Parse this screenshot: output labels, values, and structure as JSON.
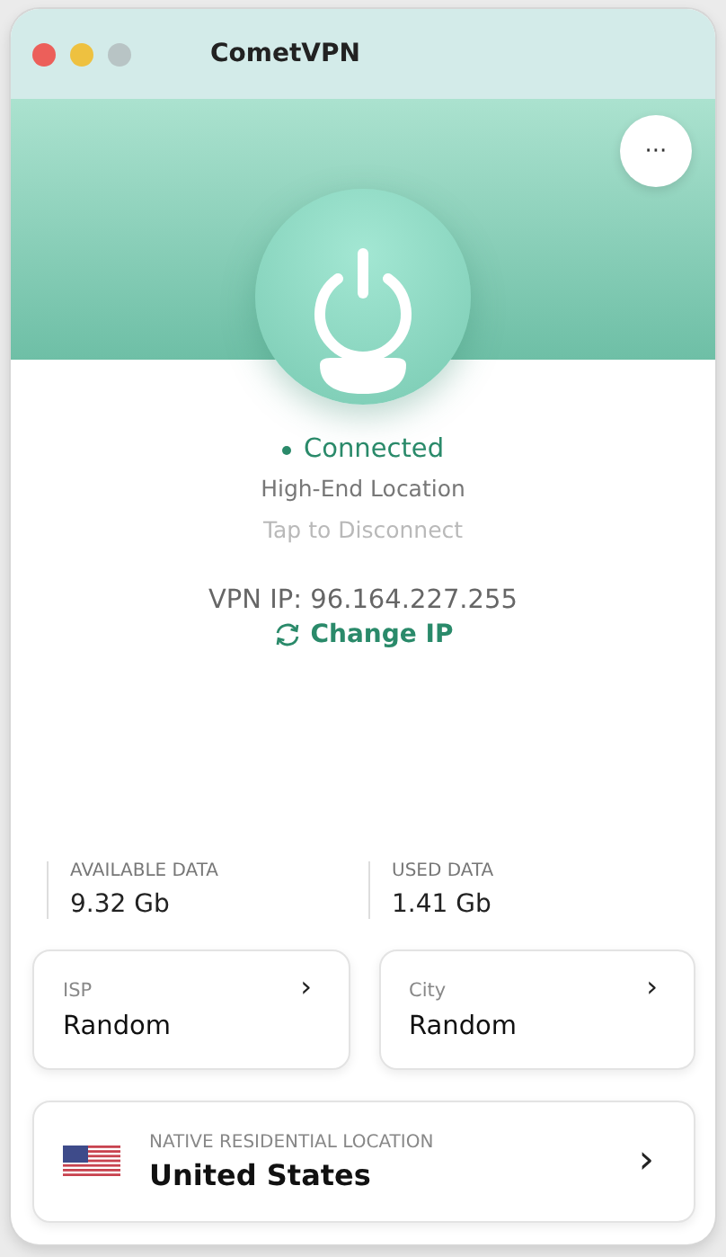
{
  "window": {
    "title": "CometVPN"
  },
  "menu_button": {
    "label": "···"
  },
  "status": {
    "label": "Connected",
    "connected": true,
    "location_tier": "High-End Location",
    "hint": "Tap to Disconnect"
  },
  "vpn_ip": {
    "text": "VPN IP: 96.164.227.255",
    "action": "Change IP"
  },
  "stats": [
    {
      "label": "AVAILABLE DATA",
      "value": "9.32 Gb"
    },
    {
      "label": "USED DATA",
      "value": "1.41 Gb"
    }
  ],
  "options": [
    {
      "label": "ISP",
      "value": "Random",
      "chevron": "›"
    },
    {
      "label": "City",
      "value": "Random",
      "chevron": "›"
    }
  ],
  "location": {
    "label": "NATIVE RESIDENTIAL LOCATION",
    "value": "United States",
    "chevron": "›"
  }
}
